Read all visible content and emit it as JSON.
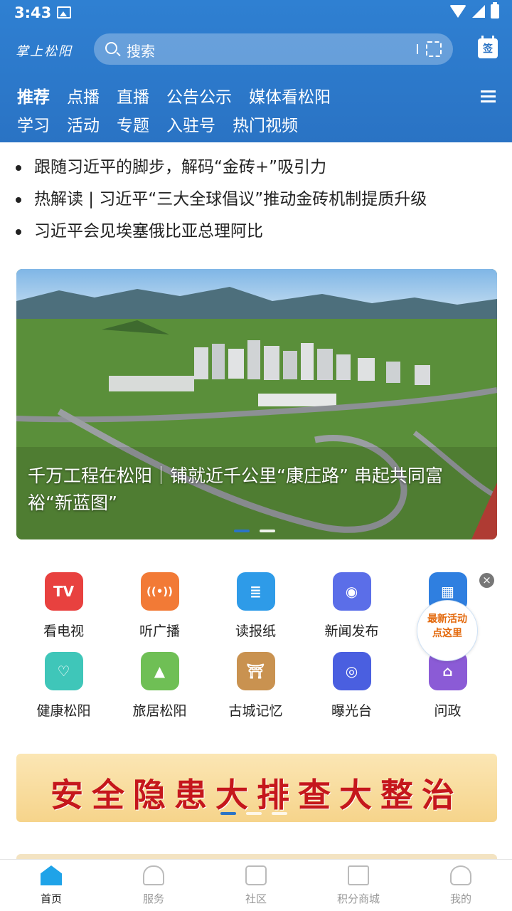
{
  "status_bar": {
    "time": "3:43"
  },
  "header": {
    "logo_text": "掌上松阳",
    "search_placeholder": "搜索",
    "checkin_label": "签",
    "tabs_row1": [
      "推荐",
      "点播",
      "直播",
      "公告公示",
      "媒体看松阳"
    ],
    "tabs_row2": [
      "学习",
      "活动",
      "专题",
      "入驻号",
      "热门视频"
    ],
    "active_tab": "推荐"
  },
  "headlines": [
    "跟随习近平的脚步，解码“金砖+”吸引力",
    "热解读 | 习近平“三大全球倡议”推动金砖机制提质升级",
    "习近平会见埃塞俄比亚总理阿比"
  ],
  "banner": {
    "caption": "千万工程在松阳｜铺就近千公里“康庄路” 串起共同富裕“新蓝图”",
    "slide_count": 2,
    "active_slide": 0
  },
  "services": [
    {
      "label": "看电视",
      "icon": "tv-icon",
      "color": "#e8413f",
      "glyph": "TV"
    },
    {
      "label": "听广播",
      "icon": "radio-icon",
      "color": "#f27a36",
      "glyph": "((•))"
    },
    {
      "label": "读报纸",
      "icon": "newspaper-icon",
      "color": "#2e9be8",
      "glyph": "≣"
    },
    {
      "label": "新闻发布",
      "icon": "press-release-icon",
      "color": "#5b6ee8",
      "glyph": "◉"
    },
    {
      "label": "",
      "icon": "apps-icon",
      "color": "#2f7fe0",
      "glyph": "▦"
    },
    {
      "label": "健康松阳",
      "icon": "health-icon",
      "color": "#3fc6b9",
      "glyph": "♡"
    },
    {
      "label": "旅居松阳",
      "icon": "mountain-icon",
      "color": "#6fbf55",
      "glyph": "▲"
    },
    {
      "label": "古城记忆",
      "icon": "ancient-gate-icon",
      "color": "#c99250",
      "glyph": "⛩"
    },
    {
      "label": "曝光台",
      "icon": "target-icon",
      "color": "#4a5fe0",
      "glyph": "◎"
    },
    {
      "label": "问政",
      "icon": "government-icon",
      "color": "#8b5bd6",
      "glyph": "⌂"
    }
  ],
  "promo_bubble": {
    "line1": "最新活动",
    "line2": "点这里"
  },
  "safety_banner": {
    "text": "安全隐患大排查大整治",
    "slide_count": 3,
    "active_slide": 0
  },
  "bottom_nav": [
    {
      "label": "首页",
      "icon": "home-icon",
      "active": true
    },
    {
      "label": "服务",
      "icon": "heart-hands-icon",
      "active": false
    },
    {
      "label": "社区",
      "icon": "community-chat-icon",
      "active": false
    },
    {
      "label": "积分商城",
      "icon": "gift-icon",
      "active": false
    },
    {
      "label": "我的",
      "icon": "user-icon",
      "active": false
    }
  ]
}
